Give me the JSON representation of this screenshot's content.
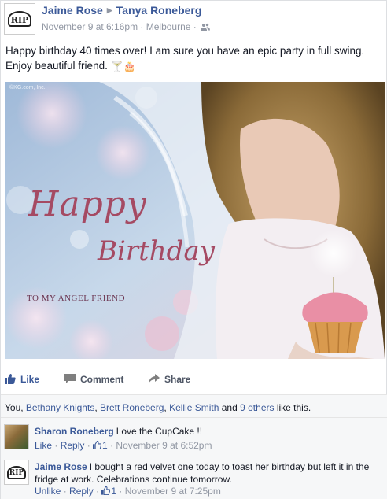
{
  "post": {
    "author": "Jaime Rose",
    "target": "Tanya Roneberg",
    "date": "November 9 at 6:16pm",
    "location": "Melbourne",
    "avatar_text": "RIP",
    "text": "Happy birthday 40 times over! I am sure you have an epic party in full swing. Enjoy beautiful friend.",
    "emojis": [
      "🍸",
      "🎂"
    ]
  },
  "photo": {
    "watermark": "©KG.com, Inc.",
    "line1": "Happy",
    "line2": "Birthday",
    "caption": "TO MY ANGEL FRIEND",
    "colors": {
      "sky": "#b5cbe3",
      "pink": "#a54a63",
      "cupcake": "#e98fa5"
    }
  },
  "actions": {
    "like": "Like",
    "comment": "Comment",
    "share": "Share"
  },
  "likes": {
    "prefix": "You, ",
    "names": [
      "Bethany Knights",
      "Brett Roneberg",
      "Kellie Smith"
    ],
    "sep1": ", ",
    "sep2": ", ",
    "and": " and ",
    "others": "9 others",
    "suffix": " like this."
  },
  "comments": [
    {
      "author": "Sharon Roneberg",
      "text": "Love the CupCake !!",
      "action1": "Like",
      "action2": "Reply",
      "like_count": "1",
      "date": "November 9 at 6:52pm"
    },
    {
      "author": "Jaime Rose",
      "text": "I bought a red velvet one today to toast her birthday but left it in the fridge at work. Celebrations continue tomorrow.",
      "action1": "Unlike",
      "action2": "Reply",
      "like_count": "1",
      "date": "November 9 at 7:25pm",
      "avatar_text": "RIP"
    }
  ],
  "separators": {
    "dot": " · "
  },
  "colors": {
    "link": "#3b5998",
    "muted": "#9197a3",
    "bg_soft": "#f6f7f8"
  }
}
